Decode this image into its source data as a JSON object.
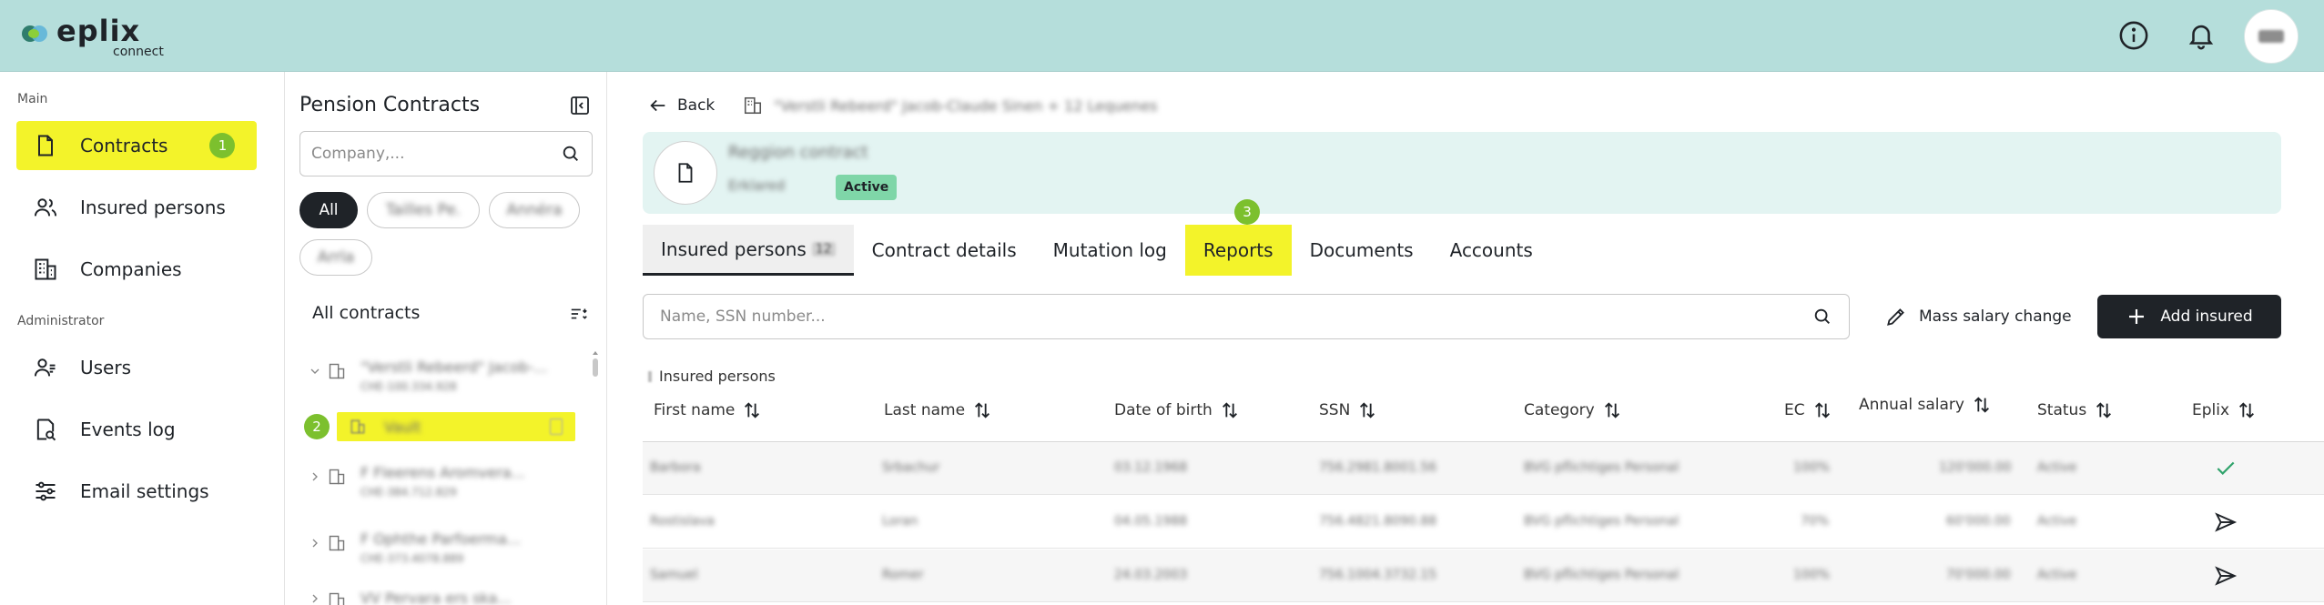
{
  "header": {
    "logo_main": "eplix",
    "logo_sub": "connect",
    "avatar_initials": "HM"
  },
  "sidenav": {
    "main_section": "Main",
    "admin_section": "Administrator",
    "items": [
      {
        "label": "Contracts",
        "icon": "document-icon",
        "badge": "1"
      },
      {
        "label": "Insured persons",
        "icon": "people-icon"
      },
      {
        "label": "Companies",
        "icon": "building-icon"
      },
      {
        "label": "Users",
        "icon": "users-icon"
      },
      {
        "label": "Events log",
        "icon": "log-search-icon"
      },
      {
        "label": "Email settings",
        "icon": "sliders-icon"
      }
    ]
  },
  "panel": {
    "title": "Pension Contracts",
    "search_placeholder": "Company,...",
    "chips": [
      "All",
      "Tailles Pe.",
      "Annéra",
      "Arrla"
    ],
    "all_contracts": "All contracts",
    "step_badge": "2",
    "tree": [
      {
        "name": "\"Verstli Rebeerd\" Jacob-...",
        "sub": "CHE-100.334.928"
      },
      {
        "name": "Vault",
        "sub": ""
      },
      {
        "name": "F Fleerens Aromvera...",
        "sub": "CHE-384.712.829"
      },
      {
        "name": "F Ophthe Parfoerma...",
        "sub": "CHE-373.4078.889"
      },
      {
        "name": "VV Pervara ers ska...",
        "sub": ""
      }
    ]
  },
  "main": {
    "back_label": "Back",
    "breadcrumb": "\"Verstli Rebeerd\" Jacob-Claude Sinen + 12 Lequenes",
    "contract_name": "Reggion contract",
    "contract_sub": "Erklared",
    "status": "Active",
    "tabs": [
      {
        "label": "Insured persons",
        "count": "12"
      },
      {
        "label": "Contract details"
      },
      {
        "label": "Mutation log"
      },
      {
        "label": "Reports"
      },
      {
        "label": "Documents"
      },
      {
        "label": "Accounts"
      }
    ],
    "step_badge": "3",
    "search_placeholder": "Name, SSN number...",
    "mass_salary_label": "Mass salary change",
    "add_insured_label": "Add insured",
    "table_caption": "Insured persons",
    "columns": [
      "First name",
      "Last name",
      "Date of birth",
      "SSN",
      "Category",
      "EC",
      "Annual salary",
      "Status",
      "Eplix"
    ],
    "rows": [
      {
        "first": "Barbora",
        "last": "Srbachur",
        "dob": "03.12.1968",
        "ssn": "756.2981.8001.56",
        "category": "BVG pflichtiges Personal",
        "ec": "100%",
        "salary": "120'000.00",
        "status": "Active",
        "eplix": "check-icon"
      },
      {
        "first": "Rostislava",
        "last": "Loran",
        "dob": "04.05.1988",
        "ssn": "756.4821.8090.88",
        "category": "BVG pflichtiges Personal",
        "ec": "70%",
        "salary": "60'000.00",
        "status": "Active",
        "eplix": "send-icon"
      },
      {
        "first": "Samuel",
        "last": "Romer",
        "dob": "24.03.2003",
        "ssn": "756.1004.3732.15",
        "category": "BVG pflichtiges Personal",
        "ec": "100%",
        "salary": "70'000.00",
        "status": "Active",
        "eplix": "send-icon"
      }
    ]
  }
}
